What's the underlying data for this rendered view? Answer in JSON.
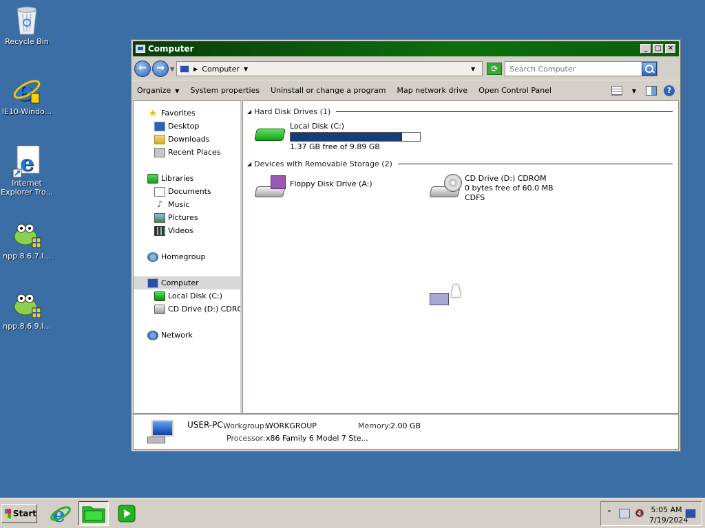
{
  "desktop": {
    "icons": [
      {
        "label": "Recycle Bin"
      },
      {
        "label": "IE10-Windo..."
      },
      {
        "label": "Internet Explorer Tro..."
      },
      {
        "label": "npp.8.6.7.I..."
      },
      {
        "label": "npp.8.6.9.I..."
      }
    ]
  },
  "window": {
    "title": "Computer",
    "address": {
      "crumb": "Computer"
    },
    "search": {
      "placeholder": "Search Computer"
    },
    "commands": {
      "organize": "Organize",
      "system_properties": "System properties",
      "uninstall": "Uninstall or change a program",
      "map_network": "Map network drive",
      "control_panel": "Open Control Panel"
    },
    "nav": {
      "favorites": "Favorites",
      "desktop": "Desktop",
      "downloads": "Downloads",
      "recent": "Recent Places",
      "libraries": "Libraries",
      "documents": "Documents",
      "music": "Music",
      "pictures": "Pictures",
      "videos": "Videos",
      "homegroup": "Homegroup",
      "computer": "Computer",
      "local_disk": "Local Disk (C:)",
      "cd_drive": "CD Drive (D:) CDROM",
      "network": "Network"
    },
    "groups": {
      "hdd": "Hard Disk Drives (1)",
      "removable": "Devices with Removable Storage (2)"
    },
    "drives": {
      "local": {
        "name": "Local Disk (C:)",
        "free": "1.37 GB free of 9.89 GB",
        "used_fraction": 0.86
      },
      "floppy": {
        "name": "Floppy Disk Drive (A:)"
      },
      "cd": {
        "name": "CD Drive (D:) CDROM",
        "free": "0 bytes free of 60.0 MB",
        "fs": "CDFS"
      }
    },
    "details": {
      "pc_name": "USER-PC",
      "workgroup_label": "Workgroup:",
      "workgroup": "WORKGROUP",
      "memory_label": "Memory:",
      "memory": "2.00 GB",
      "processor_label": "Processor:",
      "processor": "x86 Family 6 Model 7 Ste..."
    }
  },
  "taskbar": {
    "start": "Start",
    "time": "5:05 AM",
    "date": "7/19/2024"
  },
  "colors": {
    "desktop": "#3a6ea5",
    "titlebar": "#0c6f0c",
    "capacity_fill": "#163d7a"
  }
}
